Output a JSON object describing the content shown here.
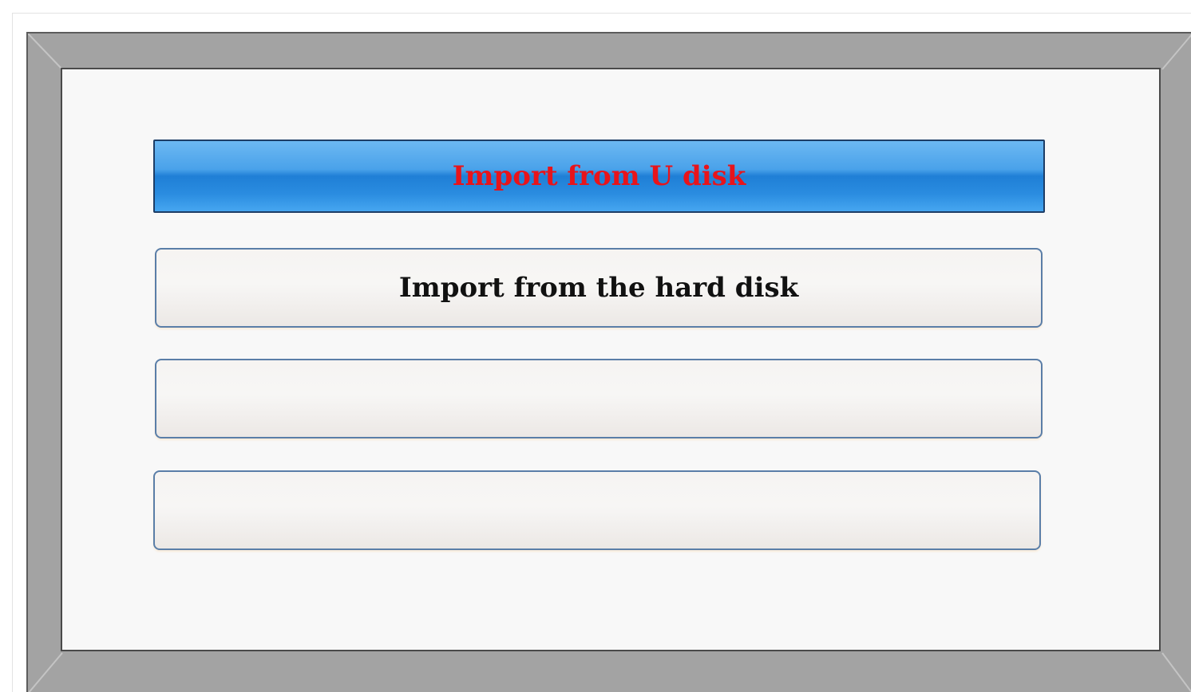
{
  "menu": {
    "items": [
      {
        "label": "Import from U disk",
        "selected": true
      },
      {
        "label": "Import from the hard disk",
        "selected": false
      },
      {
        "label": "",
        "selected": false
      },
      {
        "label": "",
        "selected": false
      }
    ]
  },
  "colors": {
    "selected_text": "#e8141b",
    "selected_fill": "#2a8ce0",
    "button_border": "#5a7ea8",
    "frame": "#a3a3a3",
    "panel": "#f8f8f8"
  }
}
